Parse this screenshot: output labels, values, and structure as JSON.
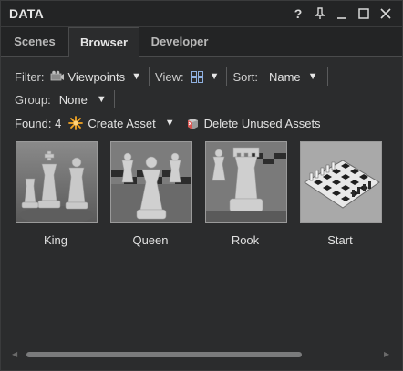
{
  "window": {
    "title": "DATA"
  },
  "titlebar_icons": [
    {
      "name": "help-icon",
      "glyph": "?"
    },
    {
      "name": "pin-icon",
      "glyph": "⊥"
    },
    {
      "name": "minimize-icon",
      "glyph": "_"
    },
    {
      "name": "maximize-icon",
      "glyph": "☐"
    },
    {
      "name": "close-icon",
      "glyph": "✕"
    }
  ],
  "tabs": [
    {
      "label": "Scenes",
      "active": false
    },
    {
      "label": "Browser",
      "active": true
    },
    {
      "label": "Developer",
      "active": false
    }
  ],
  "toolbar": {
    "filter_label": "Filter:",
    "filter_value": "Viewpoints",
    "view_label": "View:",
    "sort_label": "Sort:",
    "sort_value": "Name",
    "group_label": "Group:",
    "group_value": "None"
  },
  "actions": {
    "found_label": "Found: 4",
    "create_label": "Create Asset",
    "delete_label": "Delete Unused Assets"
  },
  "assets": [
    {
      "caption": "King"
    },
    {
      "caption": "Queen"
    },
    {
      "caption": "Rook"
    },
    {
      "caption": "Start"
    }
  ],
  "icons": {
    "filter": "camera-icon",
    "view": "grid-view-icon",
    "create": "sparkle-icon",
    "delete": "delete-assets-icon"
  },
  "colors": {
    "background": "#2b2c2d",
    "titlebar": "#232425",
    "create_icon": "#f5a623",
    "delete_icon": "#d9534f"
  }
}
